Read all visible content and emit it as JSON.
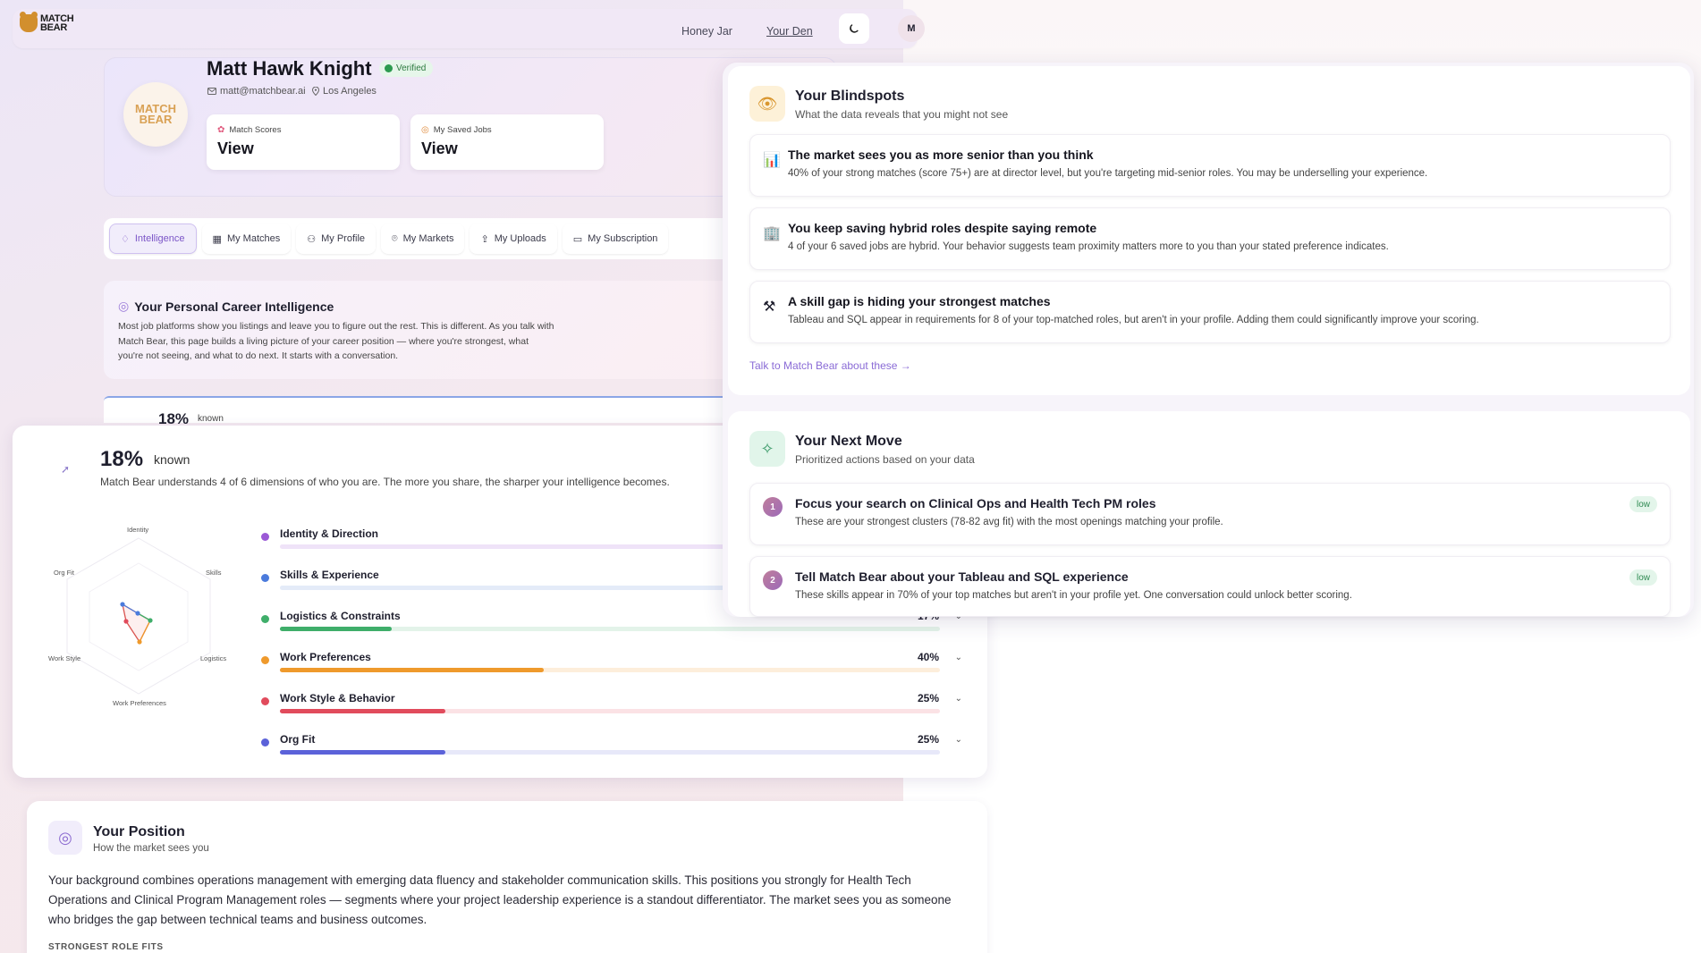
{
  "nav": {
    "logo_line1": "MATCH",
    "logo_line2": "BEAR",
    "links": [
      "Honey Jar",
      "Your Den"
    ],
    "theme_icon": "moon-icon",
    "avatar_initial": "M"
  },
  "profile": {
    "avatar_line1": "MATCH",
    "avatar_line2": "BEAR",
    "name": "Matt Hawk Knight",
    "verified_label": "Verified",
    "email": "matt@matchbear.ai",
    "location": "Los Angeles",
    "stats": [
      {
        "label": "Match Scores",
        "value": "View",
        "icon": "ribbon-icon"
      },
      {
        "label": "My Saved Jobs",
        "value": "View",
        "icon": "target-icon"
      }
    ]
  },
  "tabs": [
    {
      "label": "Intelligence",
      "icon": "bulb-icon",
      "active": true
    },
    {
      "label": "My Matches",
      "icon": "grid-icon",
      "active": false
    },
    {
      "label": "My Profile",
      "icon": "user-icon",
      "active": false
    },
    {
      "label": "My Markets",
      "icon": "pin-icon",
      "active": false
    },
    {
      "label": "My Uploads",
      "icon": "upload-icon",
      "active": false
    },
    {
      "label": "My Subscription",
      "icon": "card-icon",
      "active": false
    }
  ],
  "intelligence": {
    "title": "Your Personal Career Intelligence",
    "body": "Most job platforms show you listings and leave you to figure out the rest. This is different. As you talk with Match Bear, this page builds a living picture of your career position — where you're strongest, what you're not seeing, and what to do next. It starts with a conversation.",
    "peek_pct": "18%",
    "peek_known": "known"
  },
  "known": {
    "pct": "18%",
    "word": "known",
    "description": "Match Bear understands 4 of 6 dimensions of who you are. The more you share, the sharper your intelligence becomes.",
    "radar_labels": [
      "Identity",
      "Skills",
      "Logistics",
      "Work Preferences",
      "Work Style",
      "Org Fit"
    ],
    "dimensions": [
      {
        "name": "Identity & Direction",
        "pct": "",
        "value": null,
        "color": "#9b59d6",
        "track": "#efe3f8"
      },
      {
        "name": "Skills & Experience",
        "pct": "",
        "value": null,
        "color": "#4b7bdc",
        "track": "#e4ebf8"
      },
      {
        "name": "Logistics & Constraints",
        "pct": "17%",
        "value": 17,
        "color": "#3fae6a",
        "track": "#e3f3e9"
      },
      {
        "name": "Work Preferences",
        "pct": "40%",
        "value": 40,
        "color": "#ef9a2c",
        "track": "#fdeedb"
      },
      {
        "name": "Work Style & Behavior",
        "pct": "25%",
        "value": 25,
        "color": "#e14b5c",
        "track": "#fbe2e5"
      },
      {
        "name": "Org Fit",
        "pct": "25%",
        "value": 25,
        "color": "#5b62d9",
        "track": "#e7e8f9"
      }
    ]
  },
  "position": {
    "title": "Your Position",
    "subtitle": "How the market sees you",
    "body": "Your background combines operations management with emerging data fluency and stakeholder communication skills. This positions you strongly for Health Tech Operations and Clinical Program Management roles — segments where your project leadership experience is a standout differentiator. The market sees you as someone who bridges the gap between technical teams and business outcomes.",
    "strongest_label": "STRONGEST ROLE FITS"
  },
  "blindspots": {
    "title": "Your Blindspots",
    "subtitle": "What the data reveals that you might not see",
    "items": [
      {
        "icon": "bar-chart-icon",
        "title": "The market sees you as more senior than you think",
        "body": "40% of your strong matches (score 75+) are at director level, but you're targeting mid-senior roles. You may be underselling your experience."
      },
      {
        "icon": "office-building-icon",
        "title": "You keep saving hybrid roles despite saying remote",
        "body": "4 of your 6 saved jobs are hybrid. Your behavior suggests team proximity matters more to you than your stated preference indicates."
      },
      {
        "icon": "tools-icon",
        "title": "A skill gap is hiding your strongest matches",
        "body": "Tableau and SQL appear in requirements for 8 of your top-matched roles, but aren't in your profile. Adding them could significantly improve your scoring."
      }
    ],
    "link": "Talk to Match Bear about these →"
  },
  "next_move": {
    "title": "Your Next Move",
    "subtitle": "Prioritized actions based on your data",
    "items": [
      {
        "num": "1",
        "title": "Focus your search on Clinical Ops and Health Tech PM roles",
        "body": "These are your strongest clusters (78-82 avg fit) with the most openings matching your profile.",
        "badge": "low"
      },
      {
        "num": "2",
        "title": "Tell Match Bear about your Tableau and SQL experience",
        "body": "These skills appear in 70% of your top matches but aren't in your profile yet. One conversation could unlock better scoring.",
        "badge": "low"
      }
    ]
  }
}
